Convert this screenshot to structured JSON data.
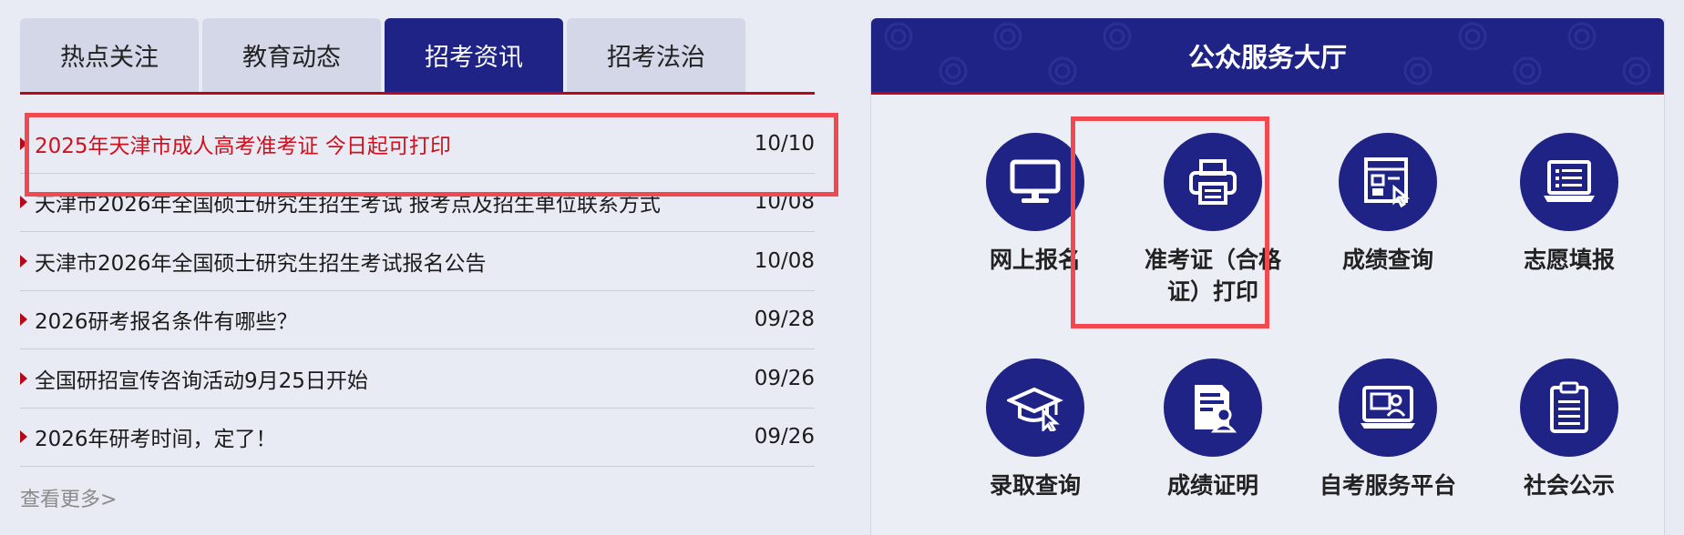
{
  "tabs": [
    {
      "label": "热点关注"
    },
    {
      "label": "教育动态"
    },
    {
      "label": "招考资讯"
    },
    {
      "label": "招考法治"
    }
  ],
  "news": [
    {
      "title": "2025年天津市成人高考准考证 今日起可打印",
      "date": "10/10"
    },
    {
      "title": "天津市2026年全国硕士研究生招生考试 报考点及招生单位联系方式",
      "date": "10/08"
    },
    {
      "title": "天津市2026年全国硕士研究生招生考试报名公告",
      "date": "10/08"
    },
    {
      "title": "2026研考报名条件有哪些？",
      "date": "09/28"
    },
    {
      "title": "全国研招宣传咨询活动9月25日开始",
      "date": "09/26"
    },
    {
      "title": "2026年研考时间，定了！",
      "date": "09/26"
    }
  ],
  "more_label": "查看更多>",
  "service": {
    "title": "公众服务大厅",
    "items": [
      {
        "label": "网上报名",
        "icon": "monitor-icon"
      },
      {
        "label": "准考证（合格证）打印",
        "icon": "printer-icon"
      },
      {
        "label": "成绩查询",
        "icon": "score-query-icon"
      },
      {
        "label": "志愿填报",
        "icon": "laptop-list-icon"
      },
      {
        "label": "录取查询",
        "icon": "graduation-cap-icon"
      },
      {
        "label": "成绩证明",
        "icon": "certificate-icon"
      },
      {
        "label": "自考服务平台",
        "icon": "self-study-platform-icon"
      },
      {
        "label": "社会公示",
        "icon": "clipboard-icon"
      }
    ]
  },
  "colors": {
    "primary": "#1e2385",
    "accent_red": "#b5091a",
    "highlight": "#f0494f",
    "hot_title": "#d0101c"
  }
}
